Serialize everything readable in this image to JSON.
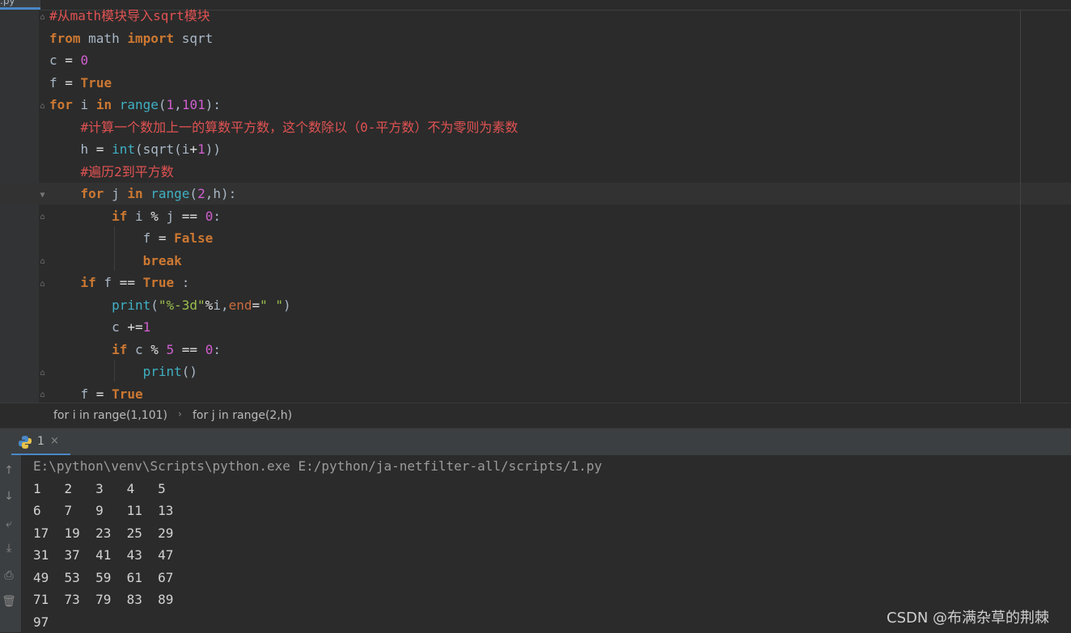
{
  "editor": {
    "tab_label": ".py",
    "lines": [
      {
        "id": "l1",
        "tokens": [
          [
            "cmt",
            "#从math模块导入sqrt模块"
          ]
        ]
      },
      {
        "id": "l2",
        "tokens": [
          [
            "kw",
            "from"
          ],
          [
            "ident",
            " math "
          ],
          [
            "kw",
            "import"
          ],
          [
            "ident",
            " sqrt"
          ]
        ]
      },
      {
        "id": "l3",
        "tokens": [
          [
            "ident",
            "c "
          ],
          [
            "op",
            "="
          ],
          [
            "ident",
            " "
          ],
          [
            "num",
            "0"
          ]
        ]
      },
      {
        "id": "l4",
        "tokens": [
          [
            "ident",
            "f "
          ],
          [
            "op",
            "="
          ],
          [
            "ident",
            " "
          ],
          [
            "tru",
            "True"
          ]
        ]
      },
      {
        "id": "l5",
        "tokens": [
          [
            "kw",
            "for"
          ],
          [
            "ident",
            " i "
          ],
          [
            "kw",
            "in"
          ],
          [
            "ident",
            " "
          ],
          [
            "fn",
            "range"
          ],
          [
            "ident",
            "("
          ],
          [
            "num",
            "1"
          ],
          [
            "ident",
            ","
          ],
          [
            "num",
            "101"
          ],
          [
            "ident",
            "):"
          ]
        ]
      },
      {
        "id": "l6",
        "tokens": [
          [
            "ident",
            "    "
          ],
          [
            "cmt",
            "#计算一个数加上一的算数平方数，这个数除以（0-平方数）不为零则为素数"
          ]
        ]
      },
      {
        "id": "l7",
        "tokens": [
          [
            "ident",
            "    h "
          ],
          [
            "op",
            "="
          ],
          [
            "ident",
            " "
          ],
          [
            "fn",
            "int"
          ],
          [
            "ident",
            "(sqrt(i"
          ],
          [
            "op",
            "+"
          ],
          [
            "num",
            "1"
          ],
          [
            "ident",
            "))"
          ]
        ]
      },
      {
        "id": "l8",
        "tokens": [
          [
            "ident",
            "    "
          ],
          [
            "cmt",
            "#遍历2到平方数"
          ]
        ]
      },
      {
        "id": "l9",
        "tokens": [
          [
            "ident",
            "    "
          ],
          [
            "kw",
            "for"
          ],
          [
            "ident",
            " j "
          ],
          [
            "kw",
            "in"
          ],
          [
            "ident",
            " "
          ],
          [
            "fn",
            "range"
          ],
          [
            "ident",
            "("
          ],
          [
            "num",
            "2"
          ],
          [
            "ident",
            ",h):"
          ]
        ]
      },
      {
        "id": "l10",
        "tokens": [
          [
            "ident",
            "        "
          ],
          [
            "kw",
            "if"
          ],
          [
            "ident",
            " i "
          ],
          [
            "op",
            "%"
          ],
          [
            "ident",
            " j "
          ],
          [
            "op",
            "=="
          ],
          [
            "ident",
            " "
          ],
          [
            "num",
            "0"
          ],
          [
            "ident",
            ":"
          ]
        ]
      },
      {
        "id": "l11",
        "tokens": [
          [
            "ident",
            "            f "
          ],
          [
            "op",
            "="
          ],
          [
            "ident",
            " "
          ],
          [
            "tru",
            "False"
          ]
        ]
      },
      {
        "id": "l12",
        "tokens": [
          [
            "ident",
            "            "
          ],
          [
            "kw",
            "break"
          ]
        ]
      },
      {
        "id": "l13",
        "tokens": [
          [
            "ident",
            "    "
          ],
          [
            "kw",
            "if"
          ],
          [
            "ident",
            " f "
          ],
          [
            "op",
            "=="
          ],
          [
            "ident",
            " "
          ],
          [
            "tru",
            "True"
          ],
          [
            "ident",
            " :"
          ]
        ]
      },
      {
        "id": "l14",
        "tokens": [
          [
            "ident",
            "        "
          ],
          [
            "fn",
            "print"
          ],
          [
            "ident",
            "("
          ],
          [
            "str2",
            "\"%-3d\""
          ],
          [
            "op",
            "%"
          ],
          [
            "ident",
            "i,"
          ],
          [
            "param",
            "end"
          ],
          [
            "op",
            "="
          ],
          [
            "str2",
            "\" \""
          ],
          [
            "ident",
            ")"
          ]
        ]
      },
      {
        "id": "l15",
        "tokens": [
          [
            "ident",
            "        c "
          ],
          [
            "op",
            "+="
          ],
          [
            "num",
            "1"
          ]
        ]
      },
      {
        "id": "l16",
        "tokens": [
          [
            "ident",
            "        "
          ],
          [
            "kw",
            "if"
          ],
          [
            "ident",
            " c "
          ],
          [
            "op",
            "%"
          ],
          [
            "ident",
            " "
          ],
          [
            "num",
            "5"
          ],
          [
            "ident",
            " "
          ],
          [
            "op",
            "=="
          ],
          [
            "ident",
            " "
          ],
          [
            "num",
            "0"
          ],
          [
            "ident",
            ":"
          ]
        ]
      },
      {
        "id": "l17",
        "tokens": [
          [
            "ident",
            "            "
          ],
          [
            "fn",
            "print"
          ],
          [
            "ident",
            "()"
          ]
        ]
      },
      {
        "id": "l18",
        "tokens": [
          [
            "ident",
            "    f "
          ],
          [
            "op",
            "="
          ],
          [
            "ident",
            " "
          ],
          [
            "tru",
            "True"
          ]
        ]
      }
    ]
  },
  "breadcrumb": {
    "items": [
      "for i in range(1,101)",
      "for j in range(2,h)"
    ],
    "separator": "›"
  },
  "run": {
    "tab_label": "1",
    "tab_close": "×",
    "side_buttons": [
      {
        "name": "up-arrow-icon",
        "glyph": "↑"
      },
      {
        "name": "down-arrow-icon",
        "glyph": "↓"
      },
      {
        "name": "soft-wrap-icon",
        "glyph": "⤶"
      },
      {
        "name": "scroll-to-end-icon",
        "glyph": "⤓"
      },
      {
        "name": "print-icon",
        "glyph": "⎙"
      },
      {
        "name": "trash-icon",
        "glyph": "🗑"
      }
    ],
    "console_lines": [
      "E:\\python\\venv\\Scripts\\python.exe E:/python/ja-netfilter-all/scripts/1.py",
      "1   2   3   4   5",
      "6   7   9   11  13",
      "17  19  23  25  29",
      "31  37  41  43  47",
      "49  53  59  61  67",
      "71  73  79  83  89",
      "97"
    ]
  },
  "watermark": "CSDN @布满杂草的荆棘"
}
